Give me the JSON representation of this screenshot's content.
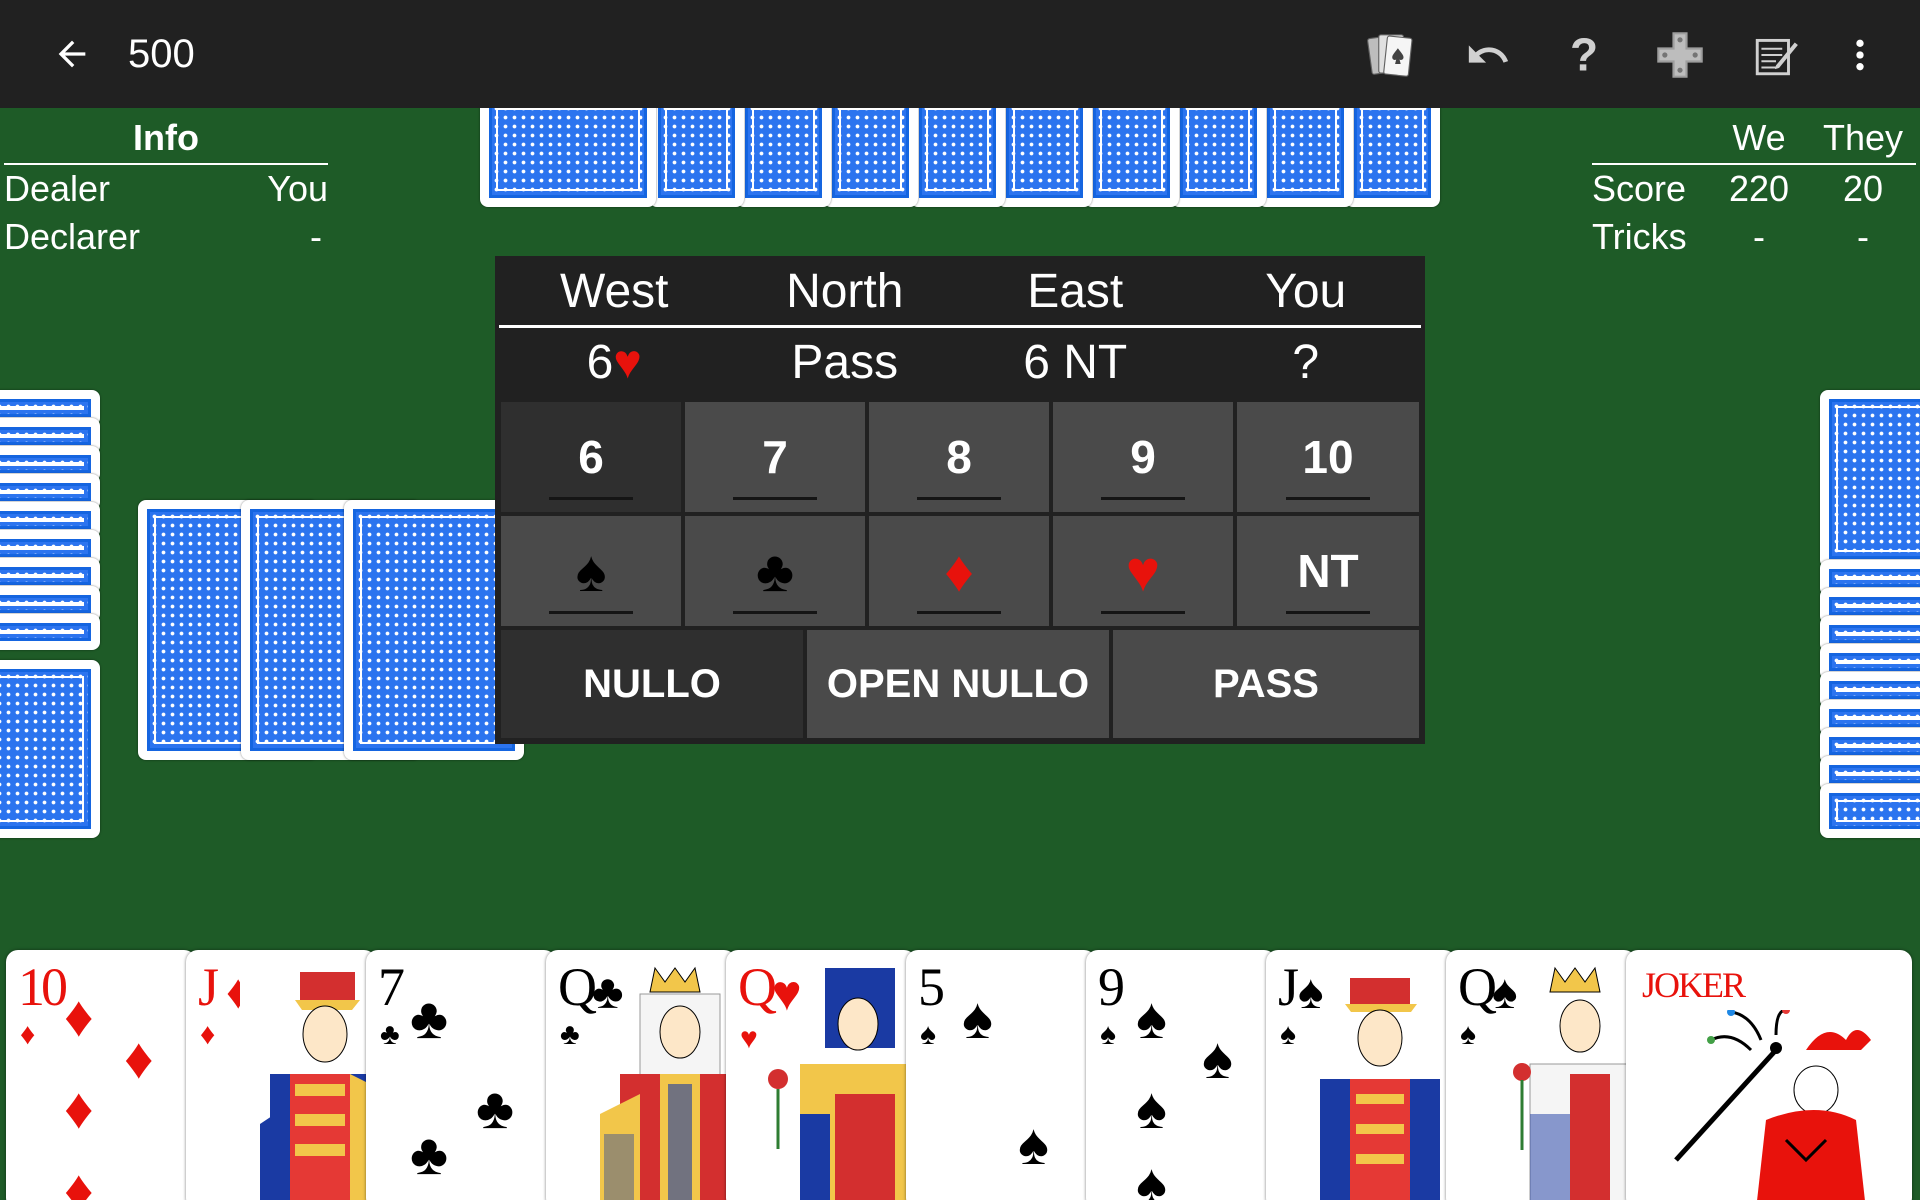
{
  "app": {
    "title": "500"
  },
  "toolbar": {
    "back_icon": "arrow-left-icon",
    "icons": [
      "cards-icon",
      "undo-icon",
      "help-icon",
      "dpad-icon",
      "scoresheet-icon",
      "more-vert-icon"
    ]
  },
  "info": {
    "header": "Info",
    "rows": [
      {
        "label": "Dealer",
        "value": "You"
      },
      {
        "label": "Declarer",
        "value": "-"
      }
    ]
  },
  "scoreboard": {
    "columns": [
      "We",
      "They"
    ],
    "rows": [
      {
        "label": "Score",
        "we": "220",
        "they": "20"
      },
      {
        "label": "Tricks",
        "we": "-",
        "they": "-"
      }
    ]
  },
  "bidding": {
    "players": [
      "West",
      "North",
      "East",
      "You"
    ],
    "bids": [
      "6",
      "Pass",
      "6 NT",
      "?"
    ],
    "west_bid_suit": "heart",
    "numbers": [
      "6",
      "7",
      "8",
      "9",
      "10"
    ],
    "selected_number": "6",
    "suits": [
      {
        "name": "spade",
        "glyph": "♠",
        "color": "#000000"
      },
      {
        "name": "club",
        "glyph": "♣",
        "color": "#000000"
      },
      {
        "name": "diamond",
        "glyph": "♦",
        "color": "#e8120c"
      },
      {
        "name": "heart",
        "glyph": "♥",
        "color": "#e8120c"
      },
      {
        "name": "nt",
        "glyph": "NT",
        "color": "#ffffff"
      }
    ],
    "actions": [
      "NULLO",
      "OPEN NULLO",
      "PASS"
    ]
  },
  "hand": [
    {
      "rank": "10",
      "suit": "♦",
      "color": "red",
      "face": false
    },
    {
      "rank": "J",
      "suit": "♦",
      "color": "red",
      "face": true
    },
    {
      "rank": "7",
      "suit": "♣",
      "color": "black",
      "face": false
    },
    {
      "rank": "Q",
      "suit": "♣",
      "color": "black",
      "face": true
    },
    {
      "rank": "Q",
      "suit": "♥",
      "color": "red",
      "face": true
    },
    {
      "rank": "5",
      "suit": "♠",
      "color": "black",
      "face": false
    },
    {
      "rank": "9",
      "suit": "♠",
      "color": "black",
      "face": false
    },
    {
      "rank": "J",
      "suit": "♠",
      "color": "black",
      "face": true
    },
    {
      "rank": "Q",
      "suit": "♠",
      "color": "black",
      "face": true
    },
    {
      "rank": "JOKER",
      "suit": "",
      "color": "red",
      "face": true
    }
  ],
  "colors": {
    "table": "#1e5b27",
    "toolbar": "#212121",
    "card_back": "#2c74ef",
    "suit_red": "#e8120c"
  }
}
